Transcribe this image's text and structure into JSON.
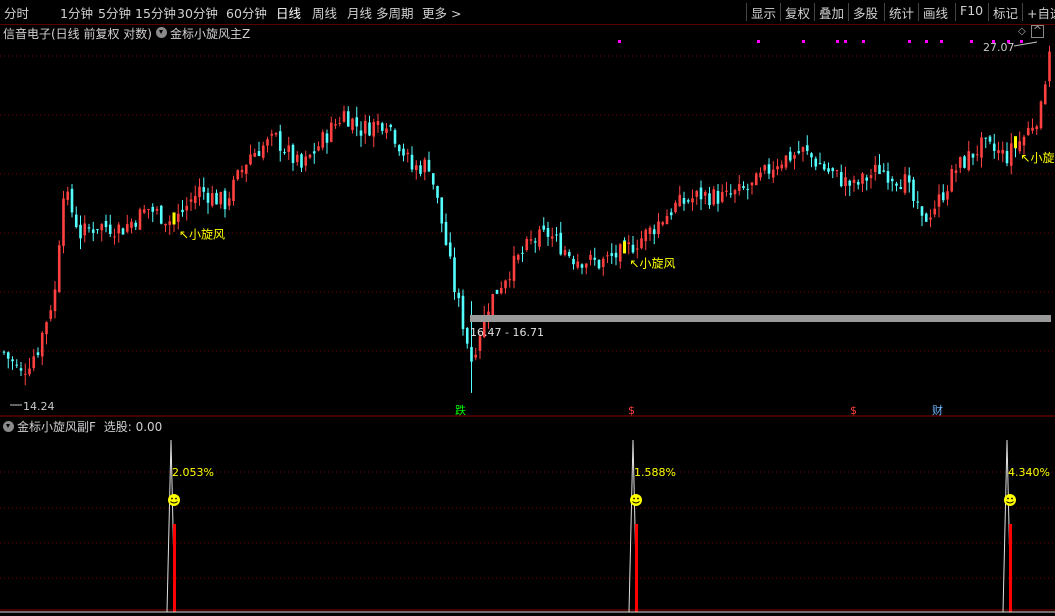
{
  "toolbar": {
    "periods": [
      "分时",
      "1分钟",
      "5分钟",
      "15分钟",
      "30分钟",
      "60分钟",
      "日线",
      "周线",
      "月线",
      "多周期",
      "更多 >"
    ],
    "active_period": "日线",
    "right_buttons": [
      "显示",
      "复权",
      "叠加",
      "多股",
      "统计",
      "画线",
      "F10",
      "标记",
      "+自选"
    ]
  },
  "header": {
    "stock_title": "信音电子(日线 前复权 对数)",
    "main_indicator": "金标小旋风主Z"
  },
  "main_chart": {
    "price_high_label": "27.07",
    "price_low_label": "14.24",
    "range_label": "16.47 - 16.71",
    "signal_label": "小旋风",
    "markers": [
      "跌",
      "$",
      "$",
      "财"
    ]
  },
  "sub_chart": {
    "indicator_label": "金标小旋风副F",
    "value_label": "选股: 0.00",
    "signal_pcts": [
      "2.053%",
      "1.588%",
      "4.340%"
    ]
  },
  "colors": {
    "up": "#ff4040",
    "down": "#54ffff",
    "grid": "#7a0000",
    "signal": "#ffff00",
    "marker_magenta": "#ff00ff"
  },
  "chart_data": {
    "type": "candlestick",
    "scale": "log",
    "price_range": [
      14.24,
      27.07
    ],
    "annotations": [
      {
        "text": "小旋风",
        "near_candle": 40
      },
      {
        "text": "小旋风",
        "near_candle": 146
      },
      {
        "text": "小旋风",
        "near_candle": 238
      }
    ]
  }
}
